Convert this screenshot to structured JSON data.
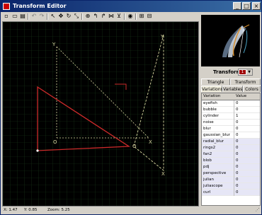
{
  "window": {
    "title": "Transform Editor"
  },
  "titlebar": {
    "min": "_",
    "max": "□",
    "close": "×"
  },
  "canvas": {
    "axis_labels": {
      "y": "Y",
      "o": "O",
      "x": "X"
    },
    "triangle_labels": {
      "y": "Y",
      "o": "O",
      "x": "X"
    }
  },
  "status": {
    "x": "X: 1.47",
    "y": "Y: 0.85",
    "zoom": "Zoom: 5.25"
  },
  "transform": {
    "label": "Transform",
    "value": "1"
  },
  "tabs": {
    "row1": [
      "Triangle",
      "Transform"
    ],
    "row2": [
      "Variations",
      "Variables",
      "Colors"
    ],
    "active": "Variations"
  },
  "grid": {
    "headers": [
      "Variation",
      "Value"
    ],
    "rows": [
      {
        "name": "eyefish",
        "value": "0"
      },
      {
        "name": "bubble",
        "value": "0"
      },
      {
        "name": "cylinder",
        "value": "1"
      },
      {
        "name": "noise",
        "value": "0"
      },
      {
        "name": "blur",
        "value": "0"
      },
      {
        "name": "gaussian_blur",
        "value": "0"
      },
      {
        "name": "radial_blur",
        "value": "0"
      },
      {
        "name": "rings2",
        "value": "0"
      },
      {
        "name": "fan2",
        "value": "0"
      },
      {
        "name": "blob",
        "value": "0"
      },
      {
        "name": "pdj",
        "value": "0"
      },
      {
        "name": "perspective",
        "value": "0"
      },
      {
        "name": "julian",
        "value": "0"
      },
      {
        "name": "juliascope",
        "value": "0"
      },
      {
        "name": "curl",
        "value": "0"
      }
    ]
  },
  "colors": {
    "canvas_bg": "#000000",
    "red_triangle": "#cc2a2a",
    "ref_triangle": "#d8d8a0",
    "selected_row": "#e6e6f6"
  }
}
